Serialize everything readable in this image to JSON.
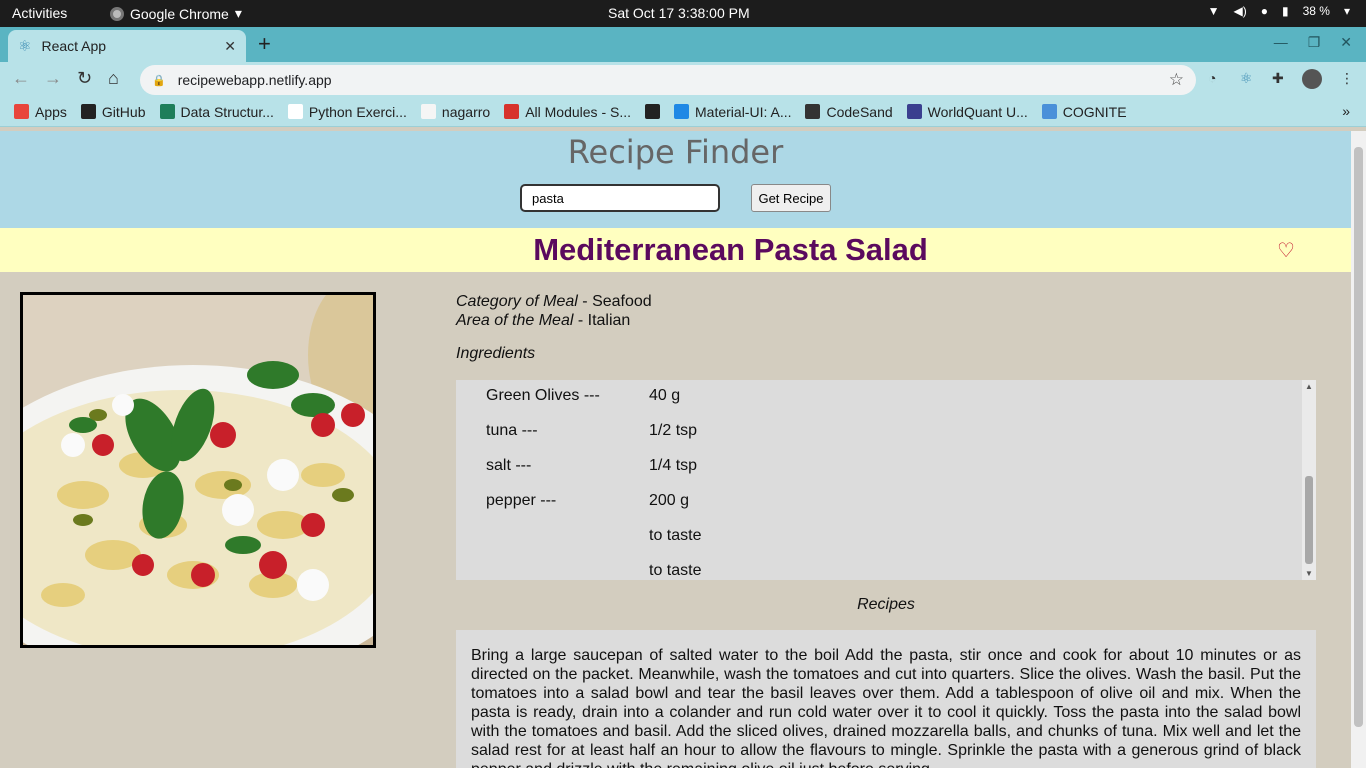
{
  "system_bar": {
    "activities": "Activities",
    "app_name": "Google Chrome",
    "clock": "Sat Oct 17   3:38:00 PM",
    "battery": "38 %"
  },
  "browser": {
    "tab_title": "React App",
    "url": "recipewebapp.netlify.app",
    "bookmarks": [
      {
        "label": "Apps",
        "icon": "apps-grid-icon",
        "color": "#e8453c"
      },
      {
        "label": "GitHub",
        "icon": "github-icon",
        "color": "#222222"
      },
      {
        "label": "Data Structur...",
        "icon": "bookmark-icon",
        "color": "#1e7e5a"
      },
      {
        "label": "Python Exerci...",
        "icon": "w3r-icon",
        "color": "#ffffff"
      },
      {
        "label": "nagarro",
        "icon": "nagarro-icon",
        "color": "#f5f5f5"
      },
      {
        "label": "All Modules - S...",
        "icon": "modules-icon",
        "color": "#d7322c"
      },
      {
        "label": "",
        "icon": "globe-icon",
        "color": "#222222"
      },
      {
        "label": "Material-UI: A...",
        "icon": "material-ui-icon",
        "color": "#1e88e5"
      },
      {
        "label": "CodeSand",
        "icon": "codesandbox-icon",
        "color": "#333333"
      },
      {
        "label": "WorldQuant U...",
        "icon": "worldquant-icon",
        "color": "#3a3f8f"
      },
      {
        "label": "COGNITE",
        "icon": "cognite-icon",
        "color": "#4a90d9"
      }
    ]
  },
  "app": {
    "title": "Recipe Finder",
    "search_value": "pasta",
    "button_label": "Get Recipe",
    "meal_name": "Mediterranean Pasta Salad",
    "category_label": "Category of Meal",
    "category": " - Seafood",
    "area_label": "Area of the Meal",
    "area": " - Italian",
    "ingredients_heading": "Ingredients",
    "ingredients": [
      "Green Olives ---",
      "tuna ---",
      "salt ---",
      "pepper ---"
    ],
    "measures": [
      "40 g",
      "1/2 tsp",
      "1/4 tsp",
      "200 g",
      "to taste",
      "to taste"
    ],
    "recipes_heading": "Recipes",
    "instructions": "Bring a large saucepan of salted water to the boil Add the pasta, stir once and cook for about 10 minutes or as directed on the packet. Meanwhile, wash the tomatoes and cut into quarters. Slice the olives. Wash the basil. Put the tomatoes into a salad bowl and tear the basil leaves over them. Add a tablespoon of olive oil and mix. When the pasta is ready, drain into a colander and run cold water over it to cool it quickly. Toss the pasta into the salad bowl with the tomatoes and basil. Add the sliced olives, drained mozzarella balls, and chunks of tuna. Mix well and let the salad rest for at least half an hour to allow the flavours to mingle. Sprinkle the pasta with a generous grind of black pepper and drizzle with the remaining olive oil just before serving."
  },
  "colors": {
    "header_bg": "#add8e6",
    "title_bar_bg": "#ffffc0",
    "meal_title": "#5b0a5e",
    "page_bg": "#d3cdbf",
    "heart": "#c0102a"
  }
}
